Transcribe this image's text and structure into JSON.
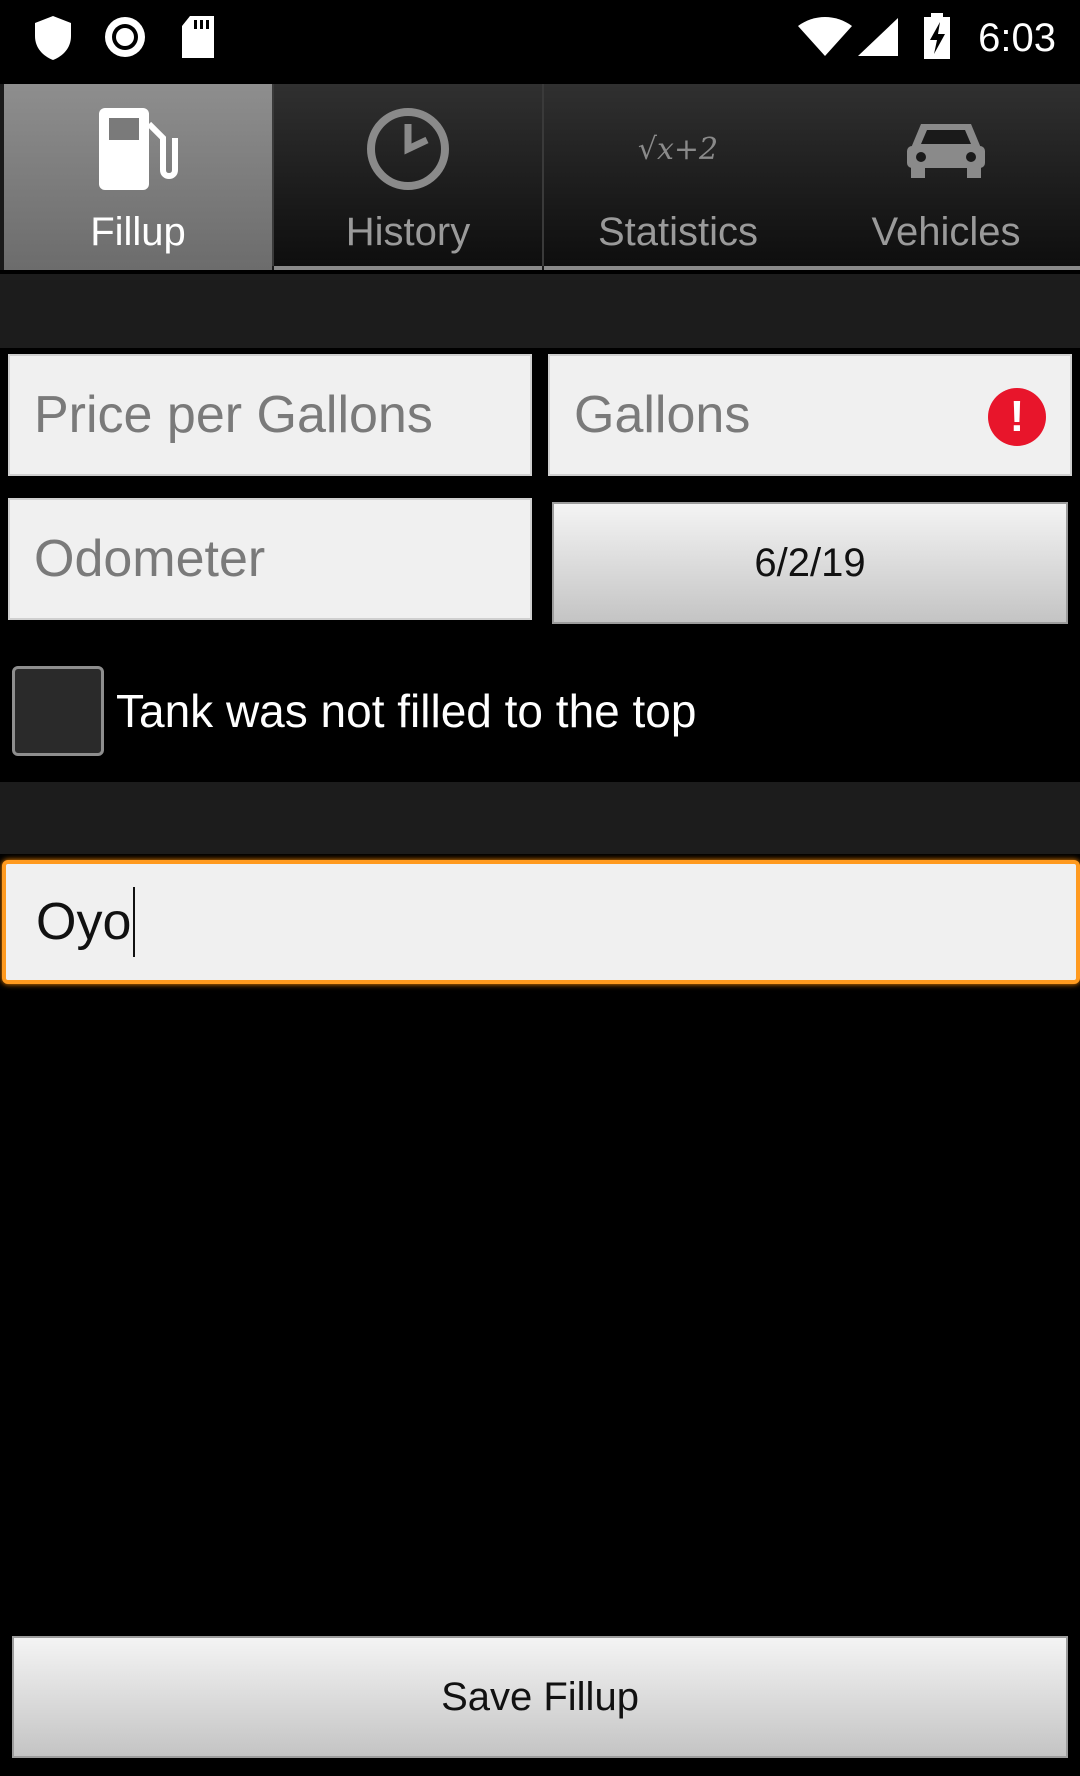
{
  "status_bar": {
    "time": "6:03",
    "left_icons": [
      "shield-icon",
      "record-icon",
      "sd-card-icon"
    ],
    "right_icons": [
      "wifi-icon",
      "signal-icon",
      "battery-charging-icon"
    ]
  },
  "tabs": [
    {
      "label": "Fillup",
      "icon": "fuel-pump-icon",
      "active": true
    },
    {
      "label": "History",
      "icon": "clock-icon",
      "active": false
    },
    {
      "label": "Statistics",
      "icon": "formula-icon",
      "icon_text": "√x+2",
      "active": false
    },
    {
      "label": "Vehicles",
      "icon": "car-icon",
      "active": false
    }
  ],
  "form": {
    "price_placeholder": "Price per Gallons",
    "gallons_placeholder": "Gallons",
    "gallons_error_symbol": "!",
    "odometer_placeholder": "Odometer",
    "date": "6/2/19",
    "partial_fill_label": "Tank was not filled to the top",
    "partial_fill_checked": false,
    "comment_value": "Oyo"
  },
  "save_button_label": "Save Fillup",
  "colors": {
    "background": "#000000",
    "focus_accent": "#ff9a1f",
    "error": "#e8152b"
  }
}
